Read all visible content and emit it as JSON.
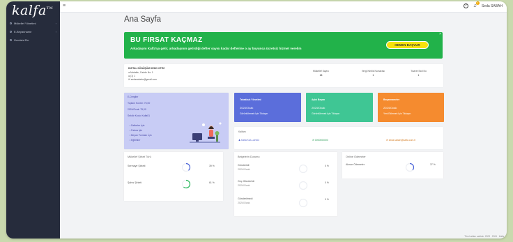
{
  "app": {
    "logo": "kalfa",
    "logo_mark": "TM"
  },
  "sidebar": {
    "items": [
      {
        "label": "Mükellef Yönetimi"
      },
      {
        "label": "E-Beyanname"
      },
      {
        "label": "Ücretsiz Ekr"
      }
    ]
  },
  "topbar": {
    "user_name": "Seda SABAH",
    "notification_count": "3"
  },
  "page": {
    "title": "Ana Sayfa"
  },
  "banner": {
    "headline": "BU FIRSAT KAÇMAZ",
    "text": "Arkadaşını Kalfa'ya getir, arkadaşının getirdiği defter sayısı kadar defterine o ay boyunca ücretsiz hizmet verelim",
    "button": "HEMEN BAŞVUR",
    "close": "×",
    "color": "#22b24a"
  },
  "office": {
    "name": "DİJİTAL DÖNÜŞÜM DEMO OFİSİ",
    "address": "Mahalle, Cadde No: 1",
    "phone": "(1) 1",
    "email": "sedasabahx@gmail.com",
    "columns": [
      {
        "label": "Mükellef Sayısı",
        "value": "18"
      },
      {
        "label": "Vergi Kimlik Numarası",
        "value": "1"
      },
      {
        "label": "Ticaret Sicil No",
        "value": "1"
      }
    ]
  },
  "info": {
    "title": "E-Dergiler",
    "subscription": "Toplam Kontör: 75,00",
    "period": "2024/Ocak: 75,00",
    "version": "Sektör Kodu: Kalfa01",
    "list": [
      "Defterler İçin",
      "Fatura İçin",
      "Beyan Formları İçin",
      "Eğitimler"
    ]
  },
  "stats": [
    {
      "title": "Tahakkuk Yönetimi",
      "value": "2024/Ocak",
      "link": "Görüntülemek İçin Tıklayın",
      "color": "#5b6edb"
    },
    {
      "title": "Aylık Beyan",
      "value": "2024/Ocak",
      "link": "Görüntülemek İçin Tıklayın",
      "color": "#3fc694"
    },
    {
      "title": "Beyannameler",
      "value": "2024/Ocak",
      "link": "Yeni Eklemek İçin Tıklayın",
      "color": "#f58b2f"
    }
  ],
  "contact": {
    "title": "Kalfam",
    "name": "Kalfa KULLANICI",
    "phone": "0000000000",
    "email": "seda.sabah@kalfa.com.tr"
  },
  "panels": {
    "taxpayer": {
      "title": "Mükellef Şirket Türü",
      "rows": [
        {
          "label": "Sermaye Şirketi",
          "pct": "39 %",
          "value": 39,
          "color": "#4a63d9"
        },
        {
          "label": "Şahıs Şirketi",
          "pct": "61 %",
          "value": 61,
          "color": "#27b85b"
        }
      ]
    },
    "documents": {
      "title": "Belgelerin Durumu",
      "rows": [
        {
          "label": "Gönderildi",
          "sub": "2024/Ocak",
          "pct": "0 %",
          "value": 0
        },
        {
          "label": "Geç Gönderildi",
          "sub": "2024/Ocak",
          "pct": "0 %",
          "value": 0
        },
        {
          "label": "Gönderilmedi",
          "sub": "2024/Ocak",
          "pct": "0 %",
          "value": 0
        }
      ]
    },
    "payments": {
      "title": "Online Ödemeler",
      "rows": [
        {
          "label": "Alınan Ödemeler",
          "pct": "37 %",
          "value": 37,
          "color": "#4a63d9"
        }
      ]
    }
  },
  "footer": {
    "text": "Tüm hakları saklıdır. 2023 · 2024 · Kalfa"
  }
}
